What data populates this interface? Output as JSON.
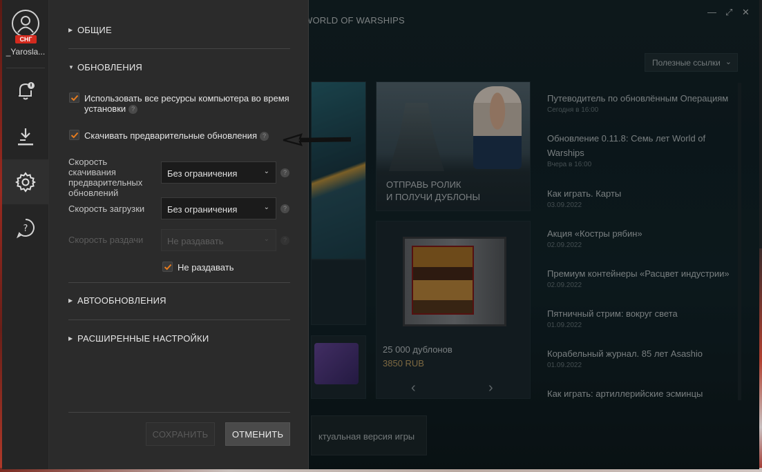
{
  "background_game": {
    "title": "WORLD OF WARSHIPS",
    "window_controls": [
      "—",
      "⤢",
      "✕"
    ],
    "useful_links": "Полезные ссылки",
    "promo_tile": {
      "line1": "ОТПРАВЬ РОЛИК",
      "line2": "И ПОЛУЧИ ДУБЛОНЫ"
    },
    "offer_tile": {
      "name": "25 000 дублонов",
      "price": "3850 RUB",
      "prev": "‹",
      "next": "›"
    },
    "current_version": "ктуальная версия игры",
    "news": [
      {
        "title": "Путеводитель по обновлённым Операциям",
        "date": "Сегодня в 16:00"
      },
      {
        "title": "Обновление 0.11.8: Семь лет World of Warships",
        "date": "Вчера в 16:00"
      },
      {
        "title": "Как играть. Карты",
        "date": "03.09.2022"
      },
      {
        "title": "Акция «Костры рябин»",
        "date": "02.09.2022"
      },
      {
        "title": "Премиум контейнеры «Расцвет индустрии»",
        "date": "02.09.2022"
      },
      {
        "title": "Пятничный стрим: вокруг света",
        "date": "01.09.2022"
      },
      {
        "title": "Корабельный журнал. 85 лет Asashio",
        "date": "01.09.2022"
      },
      {
        "title": "Как играть: артиллерийские эсминцы",
        "date": ""
      }
    ]
  },
  "rail": {
    "region": "СНГ",
    "username": "_Yarosla...",
    "icons": [
      "notifications-icon",
      "download-icon",
      "settings-icon",
      "help-icon"
    ]
  },
  "settings": {
    "sections": {
      "general": "ОБЩИЕ",
      "updates": "ОБНОВЛЕНИЯ",
      "autoupdates": "АВТООБНОВЛЕНИЯ",
      "advanced": "РАСШИРЕННЫЕ НАСТРОЙКИ"
    },
    "use_all_resources": {
      "label": "Использовать все ресурсы компьютера во время установки",
      "checked": true
    },
    "preload_updates": {
      "label": "Скачивать предварительные обновления",
      "checked": true
    },
    "preload_speed": {
      "label": "Скорость скачивания предварительных обновлений",
      "value": "Без ограничения"
    },
    "download_speed": {
      "label": "Скорость загрузки",
      "value": "Без ограничения"
    },
    "upload_speed": {
      "label": "Скорость раздачи",
      "value": "Не раздавать"
    },
    "no_seed": {
      "label": "Не раздавать",
      "checked": true
    },
    "help_glyph": "?",
    "buttons": {
      "save": "СОХРАНИТЬ",
      "cancel": "ОТМЕНИТЬ"
    }
  },
  "colors": {
    "accent_check": "#e87c1e",
    "region_badge": "#d32a1e"
  }
}
